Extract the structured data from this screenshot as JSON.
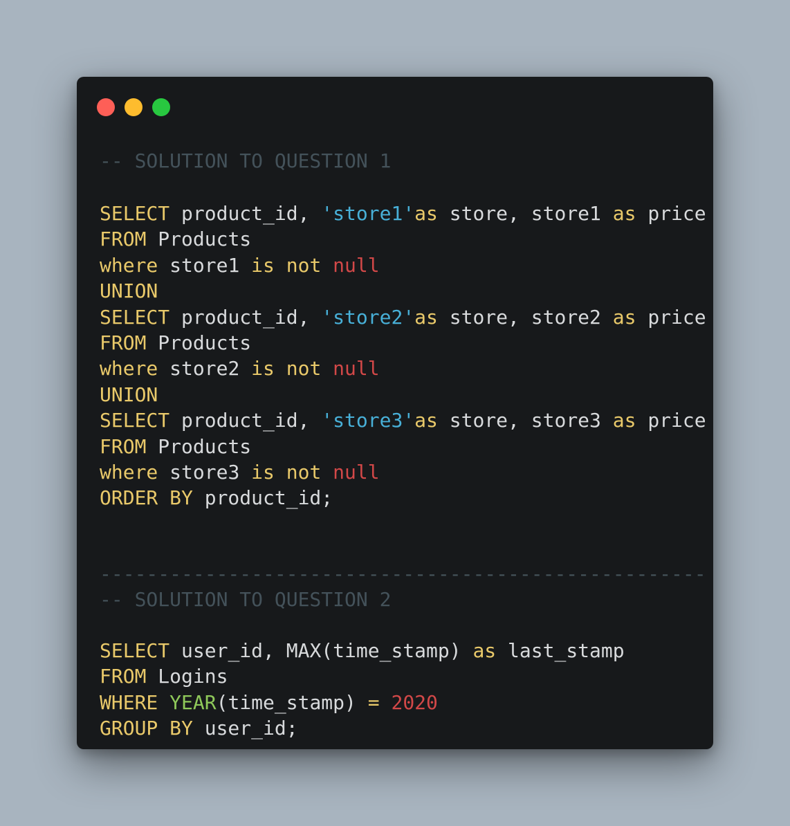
{
  "window": {
    "controls": [
      "close",
      "minimize",
      "maximize"
    ],
    "colors": {
      "background": "#17191b",
      "close": "#fe5f57",
      "minimize": "#febc2e",
      "maximize": "#28c840"
    }
  },
  "theme": {
    "keyword": "#e9c96a",
    "string": "#48b0d8",
    "null": "#d24848",
    "number": "#d24848",
    "function": "#8fc95a",
    "comment": "#44525a",
    "text": "#d8dadc"
  },
  "code": {
    "comment_q1": "-- SOLUTION TO QUESTION 1",
    "q1": [
      [
        [
          "kw",
          "SELECT"
        ],
        [
          "pl",
          " product_id, "
        ],
        [
          "str",
          "'store1'"
        ],
        [
          "kw",
          "as"
        ],
        [
          "pl",
          " store, store1 "
        ],
        [
          "kw",
          "as"
        ],
        [
          "pl",
          " price"
        ]
      ],
      [
        [
          "kw",
          "FROM"
        ],
        [
          "pl",
          " Products"
        ]
      ],
      [
        [
          "kw",
          "where"
        ],
        [
          "pl",
          " store1 "
        ],
        [
          "kw",
          "is not"
        ],
        [
          "pl",
          " "
        ],
        [
          "nul",
          "null"
        ]
      ],
      [
        [
          "kw",
          "UNION"
        ]
      ],
      [
        [
          "kw",
          "SELECT"
        ],
        [
          "pl",
          " product_id, "
        ],
        [
          "str",
          "'store2'"
        ],
        [
          "kw",
          "as"
        ],
        [
          "pl",
          " store, store2 "
        ],
        [
          "kw",
          "as"
        ],
        [
          "pl",
          " price"
        ]
      ],
      [
        [
          "kw",
          "FROM"
        ],
        [
          "pl",
          " Products"
        ]
      ],
      [
        [
          "kw",
          "where"
        ],
        [
          "pl",
          " store2 "
        ],
        [
          "kw",
          "is not"
        ],
        [
          "pl",
          " "
        ],
        [
          "nul",
          "null"
        ]
      ],
      [
        [
          "kw",
          "UNION"
        ]
      ],
      [
        [
          "kw",
          "SELECT"
        ],
        [
          "pl",
          " product_id, "
        ],
        [
          "str",
          "'store3'"
        ],
        [
          "kw",
          "as"
        ],
        [
          "pl",
          " store, store3 "
        ],
        [
          "kw",
          "as"
        ],
        [
          "pl",
          " price"
        ]
      ],
      [
        [
          "kw",
          "FROM"
        ],
        [
          "pl",
          " Products"
        ]
      ],
      [
        [
          "kw",
          "where"
        ],
        [
          "pl",
          " store3 "
        ],
        [
          "kw",
          "is not"
        ],
        [
          "pl",
          " "
        ],
        [
          "nul",
          "null"
        ]
      ],
      [
        [
          "kw",
          "ORDER BY"
        ],
        [
          "pl",
          " product_id;"
        ]
      ]
    ],
    "divider": "----------------------------------------------------------",
    "comment_q2": "-- SOLUTION TO QUESTION 2",
    "q2": [
      [
        [
          "kw",
          "SELECT"
        ],
        [
          "pl",
          " user_id, MAX(time_stamp) "
        ],
        [
          "kw",
          "as"
        ],
        [
          "pl",
          " last_stamp"
        ]
      ],
      [
        [
          "kw",
          "FROM"
        ],
        [
          "pl",
          " Logins"
        ]
      ],
      [
        [
          "kw",
          "WHERE"
        ],
        [
          "pl",
          " "
        ],
        [
          "fn",
          "YEAR"
        ],
        [
          "pl",
          "(time_stamp) "
        ],
        [
          "kw",
          "="
        ],
        [
          "pl",
          " "
        ],
        [
          "num",
          "2020"
        ]
      ],
      [
        [
          "kw",
          "GROUP BY"
        ],
        [
          "pl",
          " user_id;"
        ]
      ]
    ]
  }
}
